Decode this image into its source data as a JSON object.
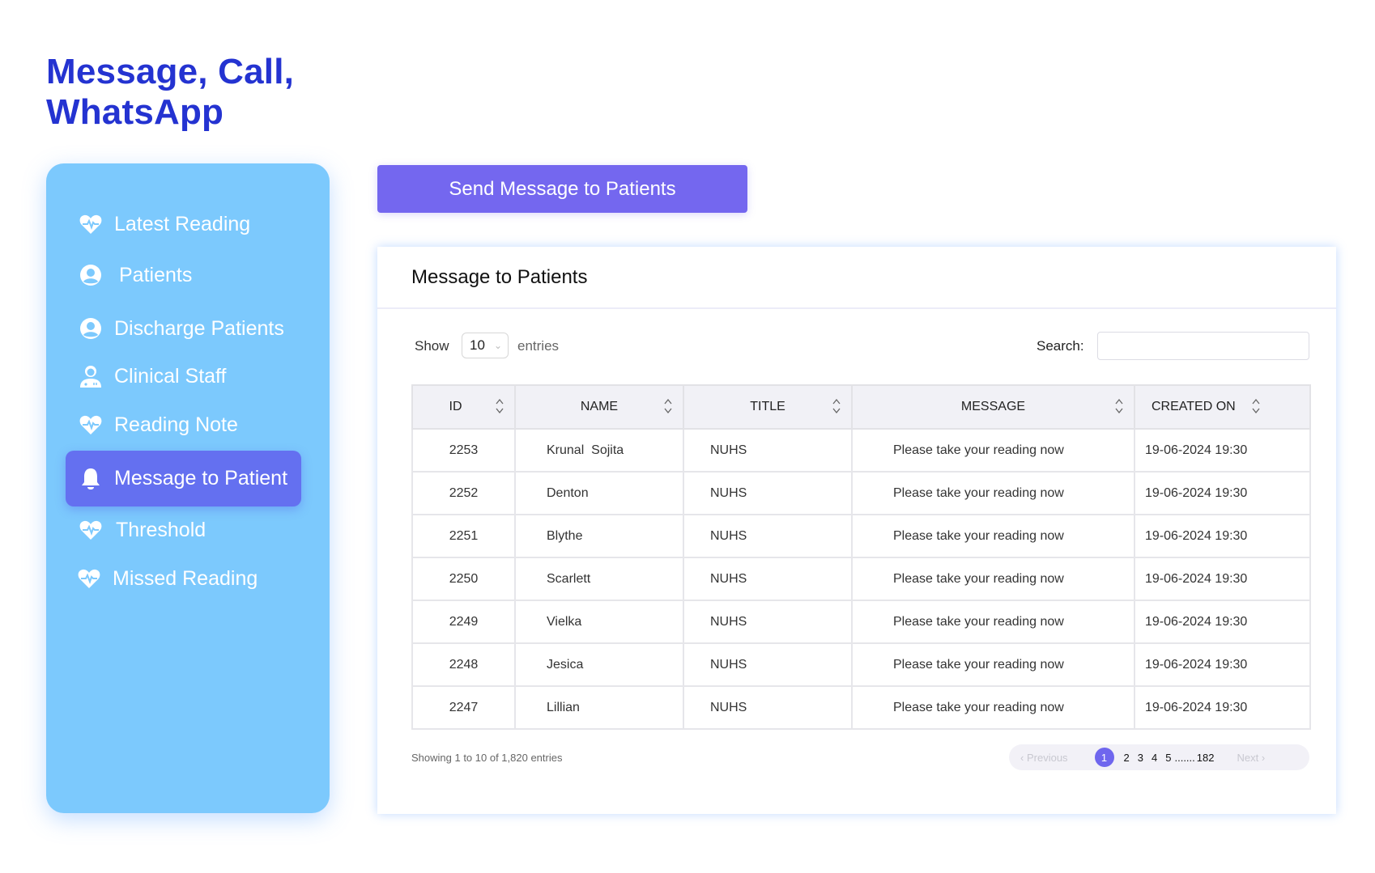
{
  "page": {
    "title_line1": "Message, Call,",
    "title_line2": "WhatsApp"
  },
  "colors": {
    "title": "#2433d1",
    "sidebar_bg": "#7cc9fd",
    "active_item": "#6470f0",
    "primary_button": "#7467ef",
    "pager_active": "#6f66ee"
  },
  "sidebar": {
    "items": [
      {
        "label": "Latest Reading",
        "icon": "heart-pulse-icon",
        "active": false
      },
      {
        "label": "Patients",
        "icon": "user-circle-icon",
        "active": false
      },
      {
        "label": "Discharge Patients",
        "icon": "user-circle-icon",
        "active": false
      },
      {
        "label": "Clinical Staff",
        "icon": "doctor-icon",
        "active": false
      },
      {
        "label": "Reading Note",
        "icon": "heart-pulse-icon",
        "active": false
      },
      {
        "label": "Message to Patient",
        "icon": "bell-icon",
        "active": true
      },
      {
        "label": "Threshold",
        "icon": "heart-pulse-icon",
        "active": false
      },
      {
        "label": "Missed Reading",
        "icon": "heart-pulse-icon",
        "active": false
      }
    ]
  },
  "toolbar": {
    "send_label": "Send Message to Patients"
  },
  "card": {
    "title": "Message to Patients",
    "show_label": "Show",
    "page_length": "10",
    "entries_label": "entries",
    "search_label": "Search:",
    "search_value": "",
    "search_placeholder": ""
  },
  "table": {
    "columns": [
      "ID",
      "NAME",
      "TITLE",
      "MESSAGE",
      "CREATED ON"
    ],
    "rows": [
      {
        "id": "2253",
        "name": "Krunal  Sojita",
        "title": "NUHS",
        "message": "Please take your reading now",
        "created_on": "19-06-2024 19:30"
      },
      {
        "id": "2252",
        "name": "Denton",
        "title": "NUHS",
        "message": "Please take your reading now",
        "created_on": "19-06-2024 19:30"
      },
      {
        "id": "2251",
        "name": "Blythe",
        "title": "NUHS",
        "message": "Please take your reading now",
        "created_on": "19-06-2024 19:30"
      },
      {
        "id": "2250",
        "name": "Scarlett",
        "title": "NUHS",
        "message": "Please take your reading now",
        "created_on": "19-06-2024 19:30"
      },
      {
        "id": "2249",
        "name": "Vielka",
        "title": "NUHS",
        "message": "Please take your reading now",
        "created_on": "19-06-2024 19:30"
      },
      {
        "id": "2248",
        "name": "Jesica",
        "title": "NUHS",
        "message": "Please take your reading now",
        "created_on": "19-06-2024 19:30"
      },
      {
        "id": "2247",
        "name": "Lillian",
        "title": "NUHS",
        "message": "Please take your reading now",
        "created_on": "19-06-2024 19:30"
      }
    ]
  },
  "footer": {
    "info": "Showing 1 to 10 of 1,820 entries",
    "prev_label": "Previous",
    "next_label": "Next",
    "pages": [
      "1",
      "2",
      "3",
      "4",
      "5"
    ],
    "current_page": "1",
    "ellipsis": ".......",
    "last_page": "182"
  }
}
